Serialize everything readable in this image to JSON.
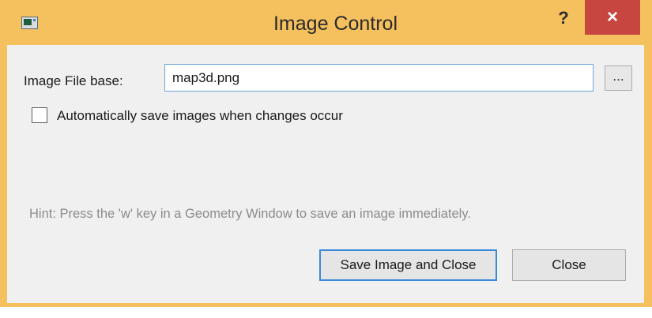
{
  "window": {
    "title": "Image Control",
    "help_label": "?",
    "close_label": "×",
    "icon": "app-window-icon"
  },
  "form": {
    "file_label": "Image File base:",
    "file_value": "map3d.png",
    "browse_label": "...",
    "autosave_label": "Automatically save images when changes occur",
    "autosave_checked": false,
    "hint": "Hint: Press the 'w' key in a Geometry Window to save an image immediately."
  },
  "buttons": {
    "save_close": "Save Image and Close",
    "close": "Close"
  },
  "colors": {
    "frame": "#f5c15e",
    "close_button": "#c7463f",
    "focus_border": "#3c8bd9"
  }
}
